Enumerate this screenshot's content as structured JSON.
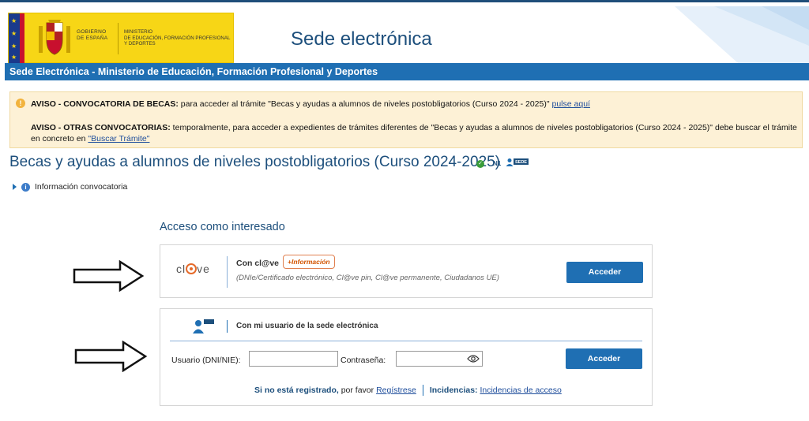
{
  "header": {
    "gov_logo_line1": "GOBIERNO",
    "gov_logo_line2": "DE ESPAÑA",
    "ministry_line1": "MINISTERIO",
    "ministry_line2": "DE EDUCACIÓN, FORMACIÓN PROFESIONAL",
    "ministry_line3": "Y DEPORTES",
    "site_title": "Sede electrónica"
  },
  "bluebar": {
    "text": "Sede Electrónica - Ministerio de Educación, Formación Profesional y Deportes"
  },
  "notice": {
    "line1_bold": "AVISO - CONVOCATORIA DE BECAS:",
    "line1_text": " para acceder al trámite \"Becas y ayudas a alumnos de niveles postobligatorios (Curso 2024 - 2025)\" ",
    "line1_link": "pulse aquí",
    "line2_bold": "AVISO - OTRAS CONVOCATORIAS:",
    "line2_text": " temporalmente, para acceder a expedientes de trámites diferentes de \"Becas y ayudas a alumnos de niveles postobligatorios (Curso 2024 - 2025)\" debe buscar el trámite en concreto en ",
    "line2_link": "\"Buscar Trámite\""
  },
  "page": {
    "heading": "Becas y ayudas a alumnos de niveles postobligatorios (Curso 2024-2025)",
    "level_badge": "N1",
    "sede_badge": "SEDE",
    "info_link": "Información convocatoria",
    "access_title": "Acceso como interesado"
  },
  "clave_box": {
    "logo_left": "cl",
    "logo_right": "ve",
    "title": "Con cl@ve",
    "more_info": "+Información",
    "subtitle": "(DNIe/Certificado electrónico, Cl@ve pin, Cl@ve permanente, Ciudadanos UE)",
    "button": "Acceder"
  },
  "user_box": {
    "title": "Con mi usuario de la sede electrónica",
    "user_label": "Usuario (DNI/NIE):",
    "user_value": "",
    "pass_label": "Contraseña:",
    "pass_value": "",
    "button": "Acceder",
    "not_registered_bold": "Si no está registrado,",
    "not_registered_text": " por favor ",
    "register_link": "Regístrese",
    "incidents_bold": "Incidencias:",
    "incidents_link": "Incidencias de acceso"
  },
  "colors": {
    "primary_blue": "#1f6fb3",
    "heading_blue": "#1d4f7c",
    "notice_bg": "#fdf1d6",
    "gov_yellow": "#f7d616",
    "clave_orange": "#e56a2a"
  }
}
